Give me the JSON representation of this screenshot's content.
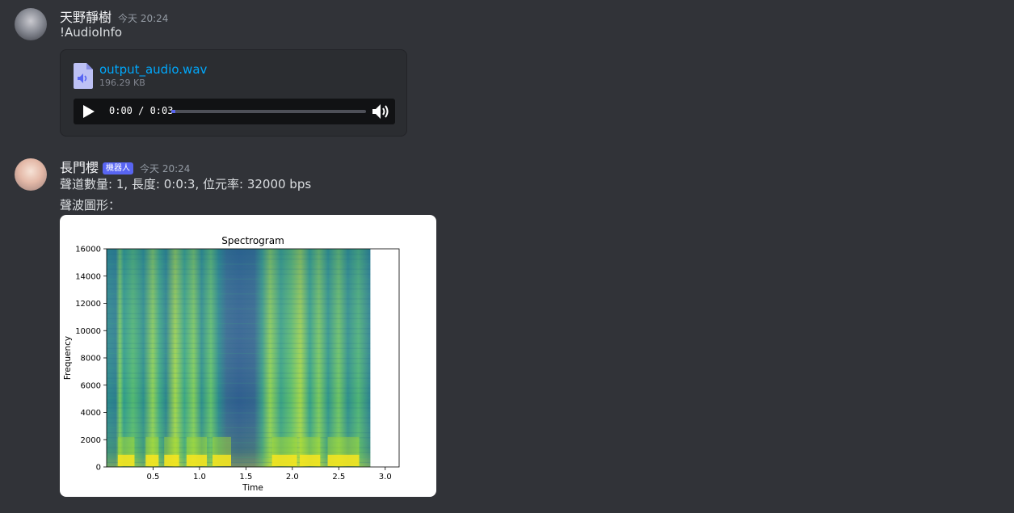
{
  "messages": [
    {
      "author": "天野靜樹",
      "time": "今天 20:24",
      "content": "!AudioInfo",
      "attachment": {
        "file_name": "output_audio.wav",
        "file_size": "196.29 KB",
        "player": {
          "time_display": "0:00 / 0:03",
          "progress": 0.02
        }
      }
    },
    {
      "author": "長門櫻",
      "badge": "機器人",
      "time": "今天 20:24",
      "line1": "聲道數量: 1, 長度: 0:0:3, 位元率: 32000 bps",
      "line2": "聲波圖形："
    }
  ],
  "chart_data": {
    "type": "heatmap",
    "title": "Spectrogram",
    "xlabel": "Time",
    "ylabel": "Frequency",
    "xlim": [
      0,
      3.15
    ],
    "ylim": [
      0,
      16000
    ],
    "x_ticks": [
      "0.5",
      "1.0",
      "1.5",
      "2.0",
      "2.5",
      "3.0"
    ],
    "y_ticks": [
      "0",
      "2000",
      "4000",
      "6000",
      "8000",
      "10000",
      "12000",
      "14000",
      "16000"
    ],
    "data_end_time": 2.84,
    "colormap": "viridis"
  },
  "icons": {
    "file": "audio-file-icon",
    "play": "play-icon",
    "volume": "volume-icon"
  },
  "colors": {
    "link": "#00a8fc",
    "badge": "#5865f2",
    "background": "#313338"
  }
}
